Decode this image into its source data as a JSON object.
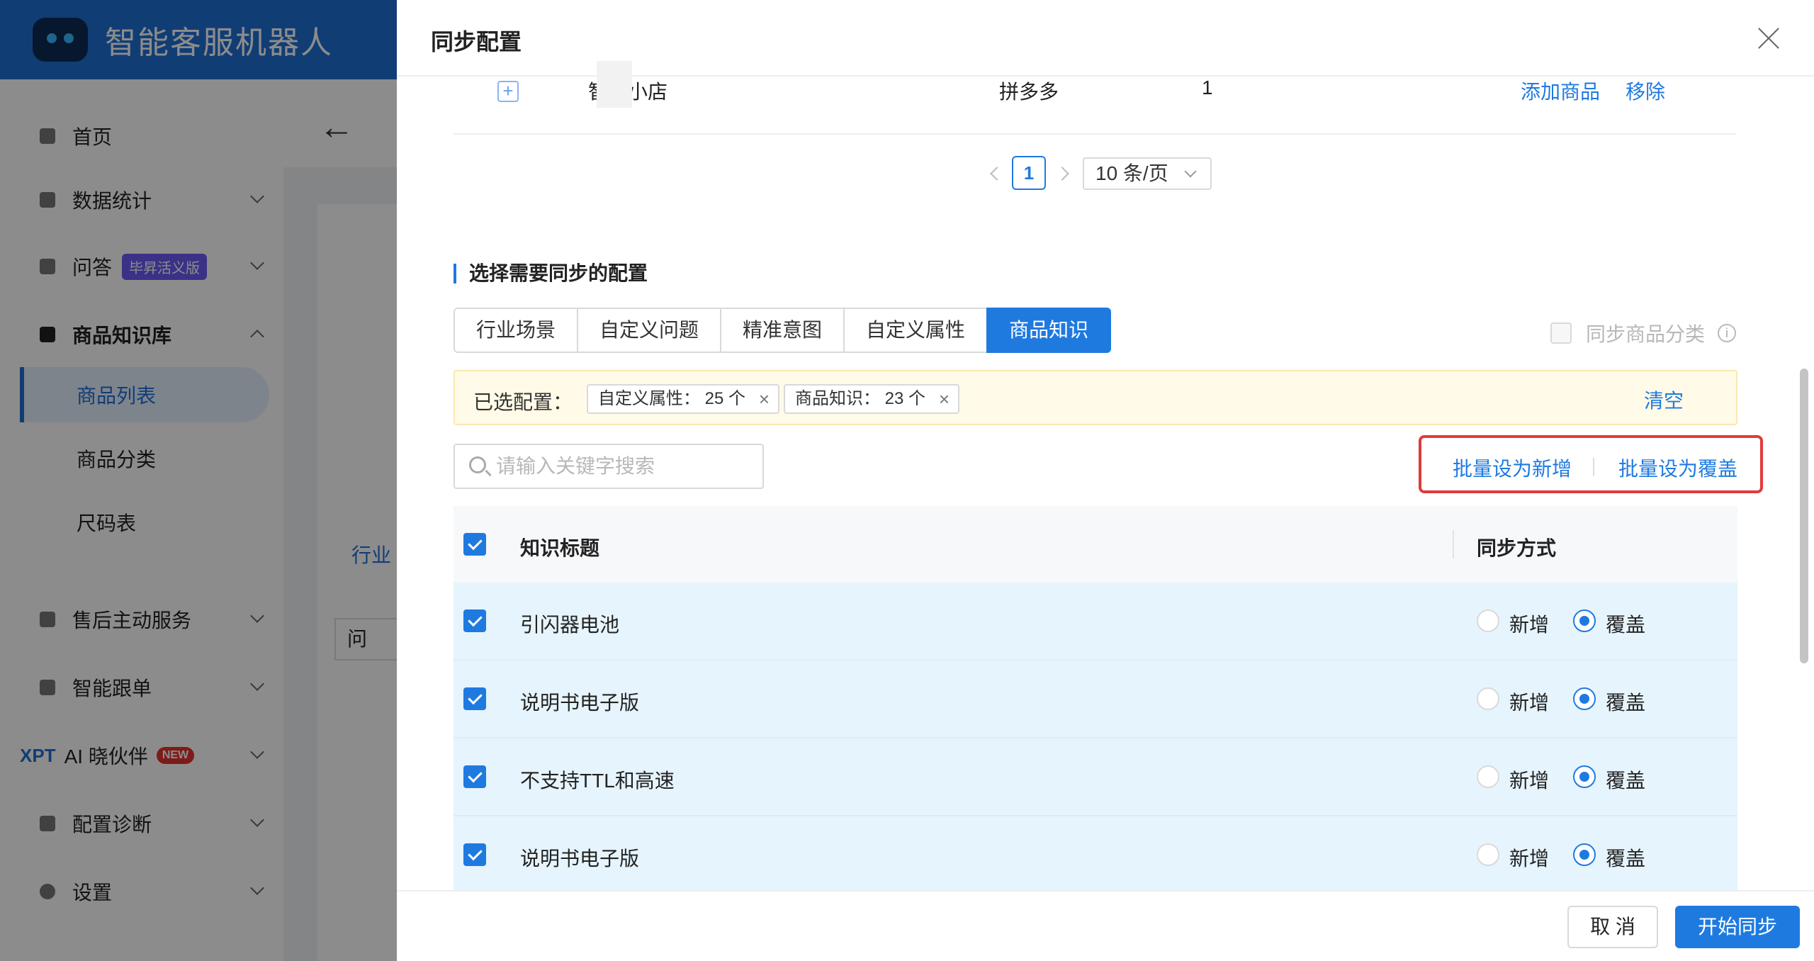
{
  "app": {
    "title": "智能客服机器人"
  },
  "sidebar": {
    "items": [
      {
        "label": "首页"
      },
      {
        "label": "数据统计"
      },
      {
        "label": "问答",
        "badge": "毕昇活义版"
      },
      {
        "label": "商品知识库"
      },
      {
        "label": "售后主动服务"
      },
      {
        "label": "智能跟单"
      },
      {
        "label": "AI 晓伙伴",
        "prefix": "XPT",
        "badge": "NEW"
      },
      {
        "label": "配置诊断"
      },
      {
        "label": "设置"
      }
    ],
    "sub_items": [
      {
        "label": "商品列表",
        "active": true
      },
      {
        "label": "商品分类"
      },
      {
        "label": "尺码表"
      }
    ]
  },
  "background": {
    "tab_fragment": "行业",
    "input_fragment": "问"
  },
  "drawer": {
    "title": "同步配置",
    "shop_row": {
      "name": "智流小店",
      "platform": "拼多多",
      "count": "1",
      "add_label": "添加商品",
      "remove_label": "移除"
    },
    "pager": {
      "current": "1",
      "page_size": "10 条/页"
    },
    "section_title": "选择需要同步的配置",
    "tabs": [
      {
        "label": "行业场景"
      },
      {
        "label": "自定义问题"
      },
      {
        "label": "精准意图"
      },
      {
        "label": "自定义属性"
      },
      {
        "label": "商品知识",
        "active": true
      }
    ],
    "sync_category_label": "同步商品分类",
    "selected": {
      "label": "已选配置：",
      "tags": [
        "自定义属性：  25 个",
        "商品知识：  23 个"
      ],
      "clear_label": "清空"
    },
    "search": {
      "placeholder": "请输入关键字搜索"
    },
    "batch": {
      "set_new": "批量设为新增",
      "set_cover": "批量设为覆盖"
    },
    "table": {
      "headers": {
        "title": "知识标题",
        "sync": "同步方式"
      },
      "options": {
        "new": "新增",
        "cover": "覆盖"
      },
      "rows": [
        {
          "title": "引闪器电池",
          "mode": "覆盖"
        },
        {
          "title": "说明书电子版",
          "mode": "覆盖"
        },
        {
          "title": "不支持TTL和高速",
          "mode": "覆盖"
        },
        {
          "title": "说明书电子版",
          "mode": "覆盖"
        }
      ]
    },
    "footer": {
      "cancel": "取 消",
      "start": "开始同步"
    }
  },
  "colors": {
    "primary": "#1f7ae0",
    "header_blue": "#1f6fd6",
    "highlight_red": "#e23a3a",
    "selected_row": "#e6f4fd",
    "notice_bg": "#fffbe8"
  }
}
